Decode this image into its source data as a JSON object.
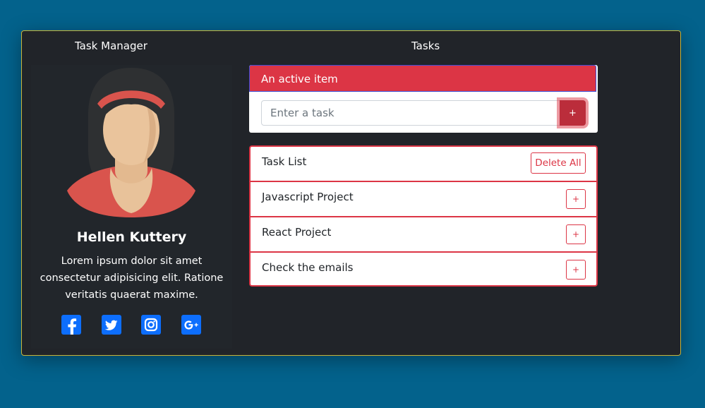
{
  "header": {
    "left_title": "Task Manager",
    "right_title": "Tasks"
  },
  "profile": {
    "name": "Hellen Kuttery",
    "bio_line1": "Lorem ipsum dolor sit amet",
    "bio_line2": "consectetur adipisicing elit. Ratione",
    "bio_line3": "veritatis quaerat maxime.",
    "socials": [
      "facebook-icon",
      "twitter-icon",
      "instagram-icon",
      "google-plus-icon"
    ]
  },
  "active_item": {
    "label": "An active item"
  },
  "task_input": {
    "placeholder": "Enter a task",
    "value": "",
    "add_label": "+"
  },
  "task_list": {
    "header": {
      "label": "Task List",
      "action_label": "Delete All"
    },
    "items": [
      {
        "label": "Javascript Project",
        "action_label": "+"
      },
      {
        "label": "React Project",
        "action_label": "+"
      },
      {
        "label": "Check the emails",
        "action_label": "+"
      }
    ]
  },
  "colors": {
    "background": "#03628c",
    "panel": "#212429",
    "accent": "#dc3545",
    "social": "#0d6efd"
  }
}
